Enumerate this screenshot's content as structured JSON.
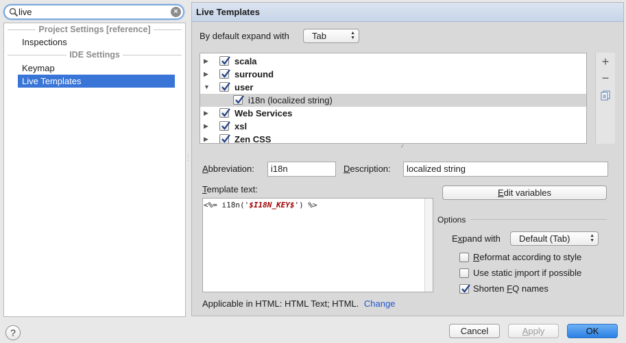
{
  "search": {
    "value": "live"
  },
  "nav": {
    "project_header": "Project Settings [reference]",
    "project_items": [
      "Inspections"
    ],
    "ide_header": "IDE Settings",
    "ide_items": [
      "Keymap",
      "Live Templates"
    ],
    "selected": "Live Templates"
  },
  "panel": {
    "title": "Live Templates",
    "expand_label": "By default expand with",
    "expand_value": "Tab"
  },
  "templates": [
    {
      "name": "scala",
      "checked": true,
      "expanded": false,
      "group": true
    },
    {
      "name": "surround",
      "checked": true,
      "expanded": false,
      "group": true
    },
    {
      "name": "user",
      "checked": true,
      "expanded": true,
      "group": true
    },
    {
      "name": "i18n (localized string)",
      "checked": true,
      "group": false,
      "selected": true
    },
    {
      "name": "Web Services",
      "checked": true,
      "expanded": false,
      "group": true
    },
    {
      "name": "xsl",
      "checked": true,
      "expanded": false,
      "group": true
    },
    {
      "name": "Zen CSS",
      "checked": true,
      "expanded": false,
      "group": true
    }
  ],
  "toolbar": {
    "add_icon": "plus-icon",
    "remove_icon": "minus-icon",
    "copy_icon": "copy-icon"
  },
  "editor": {
    "abbreviation_label_u": "A",
    "abbreviation_label_rest": "bbreviation:",
    "abbreviation_value": "i18n",
    "description_label_u": "D",
    "description_label_rest": "escription:",
    "description_value": "localized string",
    "template_text_label_u": "T",
    "template_text_label_rest": "emplate text:",
    "template_prefix": "<%= i18n('",
    "template_var": "$I18N_KEY$",
    "template_suffix": "') %>",
    "edit_variables_u": "E",
    "edit_variables_rest": "dit variables",
    "applicable_text": "Applicable in HTML: HTML Text; HTML.",
    "change_link": "Change"
  },
  "options": {
    "title": "Options",
    "expand_with_label_pre": "E",
    "expand_with_label_u": "x",
    "expand_with_label_rest": "pand with",
    "expand_with_value": "Default (Tab)",
    "reformat_u": "R",
    "reformat_rest": "eformat according to style",
    "reformat_checked": false,
    "static_import_pre": "Use static ",
    "static_import_u": "i",
    "static_import_rest": "mport if possible",
    "static_import_checked": false,
    "shorten_pre": "Shorten ",
    "shorten_u": "F",
    "shorten_rest": "Q names",
    "shorten_checked": true
  },
  "buttons": {
    "cancel": "Cancel",
    "apply_u": "A",
    "apply_rest": "pply",
    "ok": "OK",
    "help": "?"
  },
  "colors": {
    "selection": "#3875d7",
    "link": "#2255cc",
    "ok_button": "#2a80e4"
  }
}
